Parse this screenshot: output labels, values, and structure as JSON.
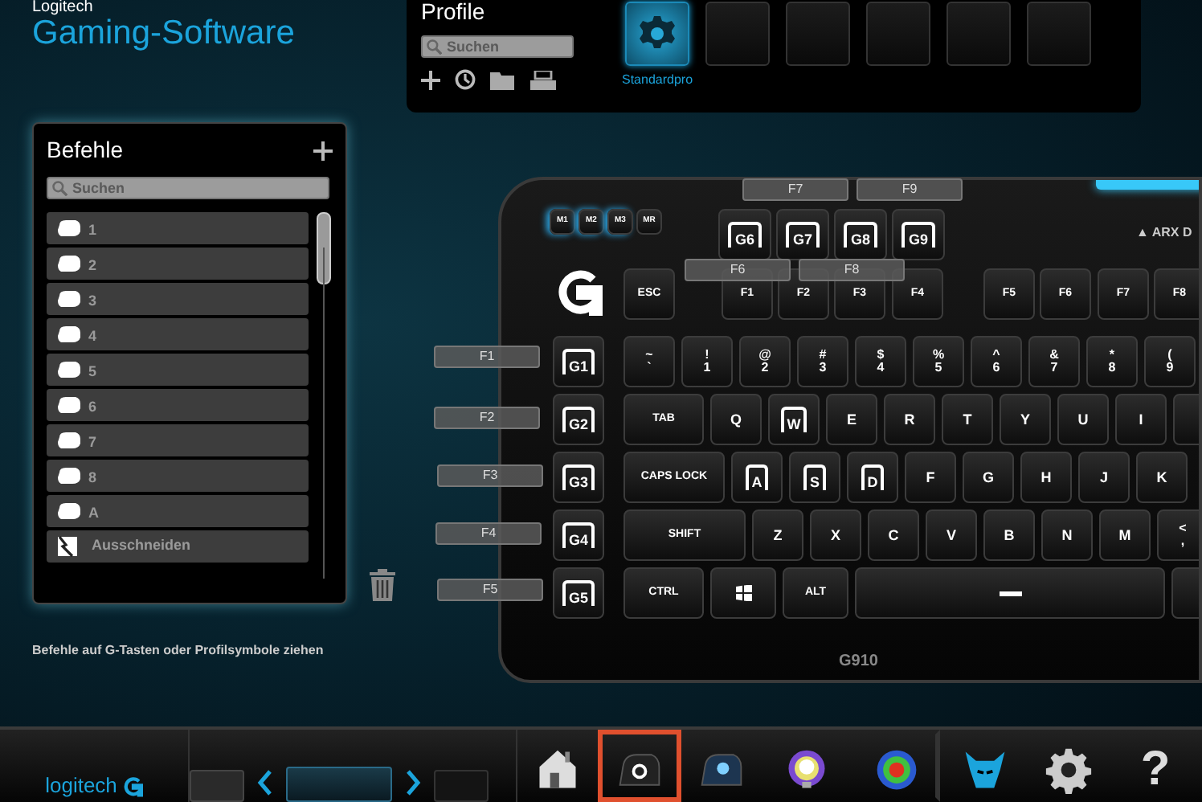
{
  "app": {
    "vendor": "Logitech",
    "title": "Gaming-Software"
  },
  "profiles": {
    "title": "Profile",
    "search": {
      "placeholder": "Suchen"
    },
    "tiles": [
      {
        "label": "Standardpro",
        "selected": true
      },
      {
        "selected": false
      },
      {
        "selected": false
      },
      {
        "selected": false
      },
      {
        "selected": false
      },
      {
        "selected": false
      }
    ]
  },
  "commands": {
    "title": "Befehle",
    "search": {
      "placeholder": "Suchen"
    },
    "items": [
      {
        "kind": "key",
        "label": "1"
      },
      {
        "kind": "key",
        "label": "2"
      },
      {
        "kind": "key",
        "label": "3"
      },
      {
        "kind": "key",
        "label": "4"
      },
      {
        "kind": "key",
        "label": "5"
      },
      {
        "kind": "key",
        "label": "6"
      },
      {
        "kind": "key",
        "label": "7"
      },
      {
        "kind": "key",
        "label": "8"
      },
      {
        "kind": "key",
        "label": "A"
      },
      {
        "kind": "cut",
        "label": "Ausschneiden"
      }
    ],
    "hint": "Befehle auf G-Tasten oder Profilsymbole ziehen"
  },
  "keyboard": {
    "mode_keys": [
      "M1",
      "M2",
      "M3",
      "MR"
    ],
    "top_g_keys": [
      "G6",
      "G7",
      "G8",
      "G9"
    ],
    "arx": "▲ ARX D",
    "function_keys": [
      "ESC",
      "F1",
      "F2",
      "F3",
      "F4",
      "F5",
      "F6",
      "F7",
      "F8"
    ],
    "g_keys": [
      "G1",
      "G2",
      "G3",
      "G4",
      "G5"
    ],
    "rows": [
      [
        {
          "kind": "dual",
          "shift": "~",
          "label": "`"
        },
        {
          "kind": "dual",
          "shift": "!",
          "label": "1"
        },
        {
          "kind": "dual",
          "shift": "@",
          "label": "2"
        },
        {
          "kind": "dual",
          "shift": "#",
          "label": "3"
        },
        {
          "kind": "dual",
          "shift": "$",
          "label": "4"
        },
        {
          "kind": "dual",
          "shift": "%",
          "label": "5"
        },
        {
          "kind": "dual",
          "shift": "^",
          "label": "6"
        },
        {
          "kind": "dual",
          "shift": "&",
          "label": "7"
        },
        {
          "kind": "dual",
          "shift": "*",
          "label": "8"
        },
        {
          "kind": "dual",
          "shift": "(",
          "label": "9"
        }
      ],
      [
        {
          "kind": "tab",
          "label": "TAB"
        },
        {
          "kind": "char",
          "label": "Q"
        },
        {
          "kind": "marked",
          "label": "W"
        },
        {
          "kind": "char",
          "label": "E"
        },
        {
          "kind": "char",
          "label": "R"
        },
        {
          "kind": "char",
          "label": "T"
        },
        {
          "kind": "char",
          "label": "Y"
        },
        {
          "kind": "char",
          "label": "U"
        },
        {
          "kind": "char",
          "label": "I"
        },
        {
          "kind": "edge"
        }
      ],
      [
        {
          "kind": "caps",
          "label": "CAPS LOCK"
        },
        {
          "kind": "marked",
          "label": "A"
        },
        {
          "kind": "marked",
          "label": "S"
        },
        {
          "kind": "marked",
          "label": "D"
        },
        {
          "kind": "char",
          "label": "F"
        },
        {
          "kind": "char",
          "label": "G"
        },
        {
          "kind": "char",
          "label": "H"
        },
        {
          "kind": "char",
          "label": "J"
        },
        {
          "kind": "char",
          "label": "K"
        }
      ],
      [
        {
          "kind": "shift",
          "label": "SHIFT"
        },
        {
          "kind": "char",
          "label": "Z"
        },
        {
          "kind": "char",
          "label": "X"
        },
        {
          "kind": "char",
          "label": "C"
        },
        {
          "kind": "char",
          "label": "V"
        },
        {
          "kind": "char",
          "label": "B"
        },
        {
          "kind": "char",
          "label": "N"
        },
        {
          "kind": "char",
          "label": "M"
        },
        {
          "kind": "dual",
          "shift": "<",
          "label": ","
        }
      ],
      [
        {
          "kind": "ctrl",
          "label": "CTRL"
        },
        {
          "kind": "win"
        },
        {
          "kind": "alt",
          "label": "ALT"
        },
        {
          "kind": "space"
        },
        {
          "kind": "edge"
        }
      ]
    ],
    "model": "G910"
  },
  "assignments": [
    {
      "label": "F7"
    },
    {
      "label": "F9"
    },
    {
      "label": "F6"
    },
    {
      "label": "F8"
    },
    {
      "label": "F1"
    },
    {
      "label": "F2"
    },
    {
      "label": "F3"
    },
    {
      "label": "F4"
    },
    {
      "label": "F5"
    }
  ],
  "toolbar": {
    "logo": "logitech",
    "tools": [
      {
        "kind": "home",
        "selected": false
      },
      {
        "kind": "gkeys",
        "selected": true
      },
      {
        "kind": "backlight",
        "selected": false
      },
      {
        "kind": "bulb",
        "selected": false
      },
      {
        "kind": "heatmap",
        "selected": false
      },
      {
        "kind": "arx",
        "selected": false
      },
      {
        "kind": "settings",
        "selected": false
      },
      {
        "kind": "help",
        "label": "?",
        "selected": false
      }
    ]
  }
}
